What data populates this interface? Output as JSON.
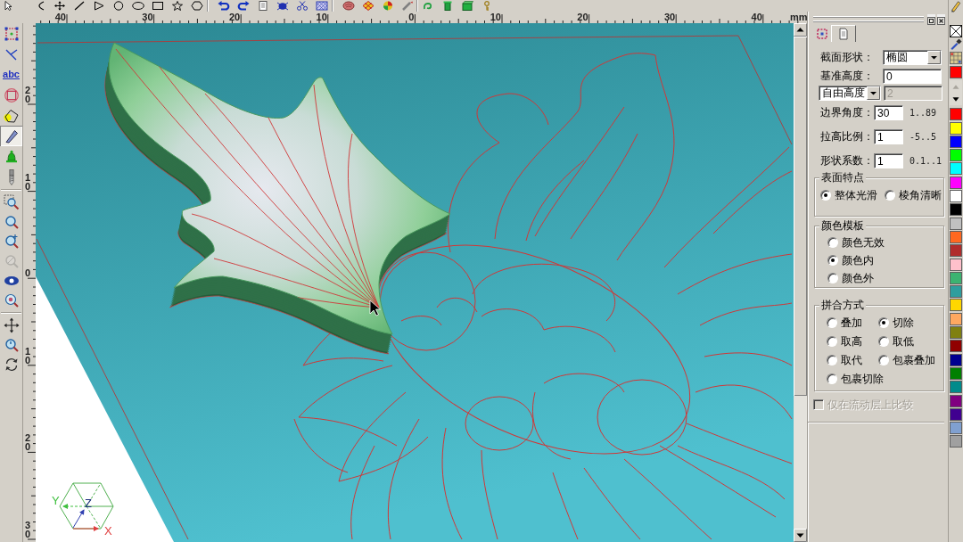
{
  "h_ruler": {
    "labels": [
      "40",
      "30",
      "20",
      "10",
      "0",
      "10",
      "20",
      "30",
      "40"
    ],
    "unit": "mm"
  },
  "v_ruler": {
    "labels": [
      "20",
      "10",
      "0",
      "10",
      "20",
      "30"
    ]
  },
  "left_toolbar": [
    {
      "selected": false,
      "disabled": false
    },
    {
      "selected": false,
      "disabled": false
    },
    {
      "label": "abc",
      "selected": false,
      "disabled": false
    },
    {
      "selected": false,
      "disabled": false
    },
    {
      "selected": false,
      "disabled": false
    },
    {
      "selected": true,
      "disabled": false
    },
    {
      "selected": false,
      "disabled": false
    },
    {
      "selected": false,
      "disabled": false
    },
    {
      "selected": false,
      "disabled": false
    },
    {
      "selected": false,
      "disabled": false
    },
    {
      "selected": false,
      "disabled": false
    },
    {
      "selected": false,
      "disabled": true
    },
    {
      "selected": false,
      "disabled": false
    },
    {
      "selected": false,
      "disabled": false
    },
    {
      "selected": false,
      "disabled": false
    },
    {
      "selected": false,
      "disabled": false
    },
    {
      "selected": false,
      "disabled": false
    }
  ],
  "viewport": {
    "axes": {
      "y": "Y",
      "z": "Z",
      "x": "X"
    }
  },
  "panel": {
    "tabs": [
      {
        "selected": false
      },
      {
        "selected": true
      }
    ],
    "fields": [
      {
        "kind": "select",
        "label": "截面形状：",
        "value": "椭圆"
      },
      {
        "kind": "input",
        "label": "基准高度：",
        "value": "0"
      },
      {
        "kind": "select_input",
        "option": "自由高度",
        "value": "2",
        "disabled": true
      },
      {
        "kind": "range",
        "label": "边界角度：",
        "value": "30",
        "range": "1..89"
      },
      {
        "kind": "range",
        "label": "拉高比例：",
        "value": "1",
        "range": "-5..5"
      },
      {
        "kind": "range",
        "label": "形状系数：",
        "value": "1",
        "range": "0.1..1"
      }
    ],
    "groups": [
      {
        "title": "表面特点",
        "options": [
          {
            "label": "整体光滑",
            "selected": true
          },
          {
            "label": "棱角清晰",
            "selected": false
          }
        ]
      },
      {
        "title": "颜色模板",
        "options": [
          {
            "label": "颜色无效",
            "selected": false
          },
          {
            "label": "颜色内",
            "selected": true
          },
          {
            "label": "颜色外",
            "selected": false
          }
        ]
      },
      {
        "title": "拼合方式",
        "options": [
          {
            "label": "叠加",
            "selected": false
          },
          {
            "label": "切除",
            "selected": true
          },
          {
            "label": "取高",
            "selected": false
          },
          {
            "label": "取低",
            "selected": false
          },
          {
            "label": "取代",
            "selected": false
          },
          {
            "label": "包裹叠加",
            "selected": false
          },
          {
            "label": "包裹切除",
            "selected": false
          }
        ]
      }
    ],
    "checkbox": {
      "label": "仅在流动层上比较",
      "checked": false,
      "disabled": true
    }
  },
  "palette": {
    "current": {
      "color": "#ff0000"
    },
    "swatches": [
      {
        "color": "#ff0000"
      },
      {
        "color": "#ffff00"
      },
      {
        "color": "#0000ff"
      },
      {
        "color": "#00ff00"
      },
      {
        "color": "#00ffff"
      },
      {
        "color": "#ff00ff"
      },
      {
        "color": "#ffffff"
      },
      {
        "color": "#000000"
      },
      {
        "color": "#c0c0c0"
      },
      {
        "color": "#ff6820"
      },
      {
        "color": "#b02c2c"
      },
      {
        "color": "#ffc0cb"
      },
      {
        "color": "#3cb371"
      },
      {
        "color": "#2e9e9e"
      },
      {
        "color": "#ffd700"
      },
      {
        "color": "#ffa860"
      },
      {
        "color": "#808010"
      },
      {
        "color": "#900000"
      },
      {
        "color": "#000090"
      },
      {
        "color": "#008000"
      },
      {
        "color": "#008b8b"
      },
      {
        "color": "#800080"
      },
      {
        "color": "#400090"
      },
      {
        "color": "#80a0d0"
      },
      {
        "color": "#a0a0a0"
      }
    ]
  }
}
